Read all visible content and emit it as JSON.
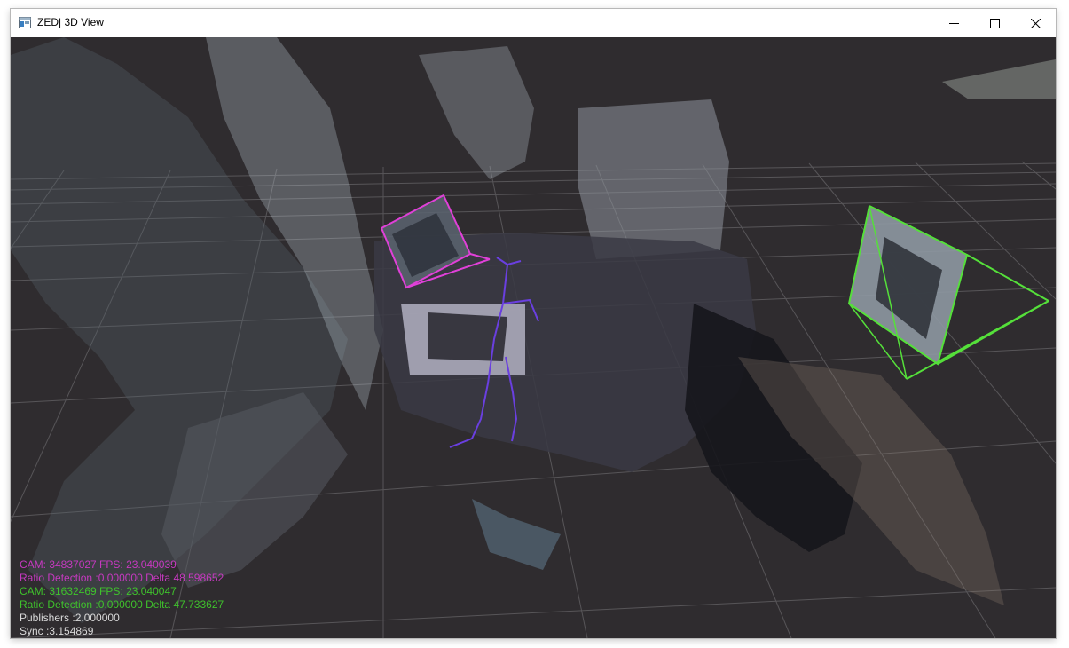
{
  "window": {
    "title": "ZED| 3D View",
    "icon": "zed-app-icon",
    "controls": {
      "minimize_icon": "minimize-icon",
      "maximize_icon": "maximize-icon",
      "close_icon": "close-icon"
    }
  },
  "scene": {
    "background_color": "#2f2c2f",
    "grid_color": "#6a686b",
    "camera_1_frustum_color": "#e040d8",
    "camera_2_frustum_color": "#55e03a",
    "skeleton_color": "#6a3fe0"
  },
  "overlay": {
    "cam1_line": "CAM: 34837027 FPS: 23.040039",
    "cam1_ratio": "Ratio Detection :0.000000 Delta 48.598652",
    "cam2_line": "CAM: 31632469 FPS: 23.040047",
    "cam2_ratio": "Ratio Detection :0.000000 Delta 47.733627",
    "publishers": "Publishers :2.000000",
    "sync": "Sync :3.154869",
    "cam1_color": "#c639c0",
    "cam2_color": "#3fc22c",
    "info_color": "#d9d9d9"
  }
}
